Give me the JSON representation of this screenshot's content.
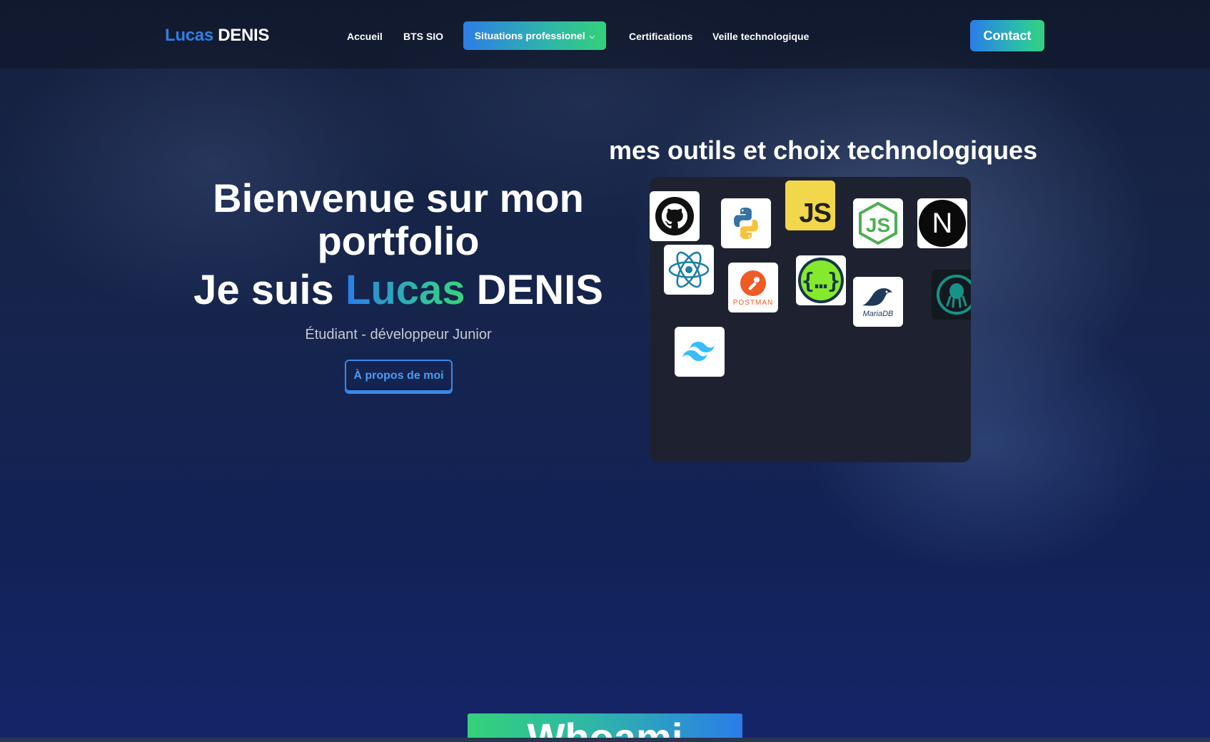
{
  "nav": {
    "logo_first": "Lucas",
    "logo_last": "DENIS",
    "items": [
      "Accueil",
      "BTS SIO",
      "Certifications",
      "Veille technologique"
    ],
    "dropdown_label": "Situations professionel",
    "contact_label": "Contact"
  },
  "hero": {
    "title_line1": "Bienvenue sur mon portfolio",
    "title_line2_prefix": "Je suis",
    "name_first": "Lucas",
    "name_last": "DENIS",
    "subtitle": "Étudiant - développeur Junior",
    "about_button": "À propos de moi"
  },
  "tools": {
    "title": "mes outils et choix technologiques",
    "icons": [
      "github-icon",
      "python-icon",
      "javascript-icon",
      "nodejs-icon",
      "nextjs-icon",
      "react-icon",
      "postman-icon",
      "swagger-icon",
      "mariadb-icon",
      "gitkraken-icon",
      "tailwind-icon"
    ],
    "tile_labels": {
      "javascript": "JS",
      "nextjs": "N",
      "postman": "POSTMAN",
      "mariadb": "MariaDB"
    }
  },
  "section_next": {
    "title": "Whoami"
  },
  "colors": {
    "brand_blue": "#2f7fe6",
    "brand_green": "#35d27d",
    "panel_bg": "#1e2230"
  }
}
